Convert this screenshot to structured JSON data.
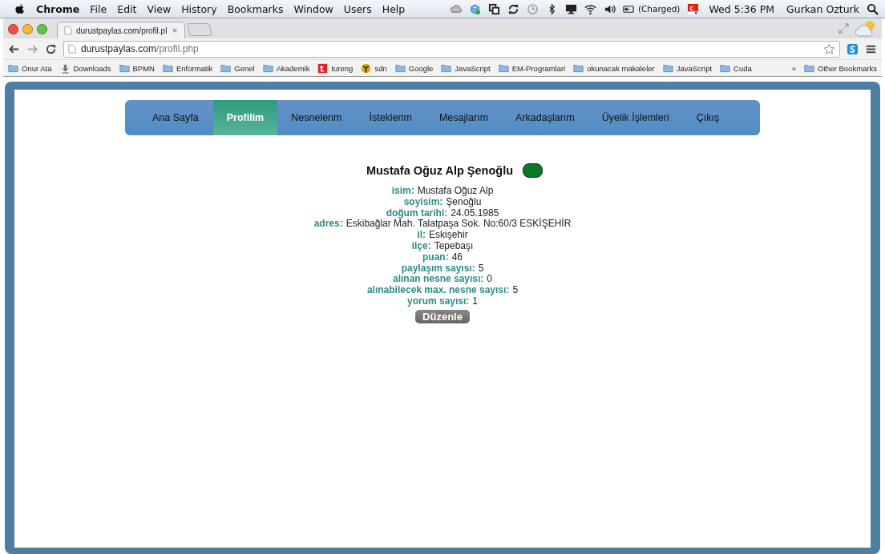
{
  "menu_bar": {
    "app": "Chrome",
    "items": [
      "File",
      "Edit",
      "View",
      "History",
      "Bookmarks",
      "Window",
      "Users",
      "Help"
    ],
    "battery": "(Charged)",
    "clock": "Wed 5:36 PM",
    "user": "Gurkan Ozturk"
  },
  "tabs": [
    {
      "label": "durustpaylas.com/profil.pl",
      "selected": true
    }
  ],
  "address": {
    "host": "durustpaylas.com",
    "path": "/profil.php"
  },
  "bookmarks": [
    {
      "label": "Onur Ata",
      "kind": "folder"
    },
    {
      "label": "Downloads",
      "kind": "download"
    },
    {
      "label": "BPMN",
      "kind": "folder"
    },
    {
      "label": "Enformatik",
      "kind": "folder"
    },
    {
      "label": "Genel",
      "kind": "folder"
    },
    {
      "label": "Akademik",
      "kind": "folder"
    },
    {
      "label": "tureng",
      "kind": "tureng"
    },
    {
      "label": "sdn",
      "kind": "sdn"
    },
    {
      "label": "Google",
      "kind": "folder"
    },
    {
      "label": "JavaScript",
      "kind": "folder"
    },
    {
      "label": "EM-Programlari",
      "kind": "folder"
    },
    {
      "label": "okunacak makaleler",
      "kind": "folder"
    },
    {
      "label": "JavaScript",
      "kind": "folder"
    },
    {
      "label": "Cuda",
      "kind": "folder"
    }
  ],
  "overflow": "»",
  "other_bookmarks": "Other Bookmarks",
  "nav": [
    {
      "label": "Ana Sayfa",
      "selected": false
    },
    {
      "label": "Profilim",
      "selected": true
    },
    {
      "label": "Nesnelerim",
      "selected": false
    },
    {
      "label": "İsteklerim",
      "selected": false
    },
    {
      "label": "Mesajlarım",
      "selected": false
    },
    {
      "label": "Arkadaşlarım",
      "selected": false
    },
    {
      "label": "Üyelik İşlemleri",
      "selected": false
    },
    {
      "label": "Çıkış",
      "selected": false
    }
  ],
  "profile": {
    "name": "Mustafa Oğuz Alp Şenoğlu",
    "status": {
      "color": "#08782a"
    },
    "fields": [
      {
        "label": "isim:",
        "value": "Mustafa Oğuz Alp"
      },
      {
        "label": "soyisim:",
        "value": "Şenoğlu"
      },
      {
        "label": "doğum tarihi:",
        "value": "24.05.1985"
      },
      {
        "label": "adres:",
        "value": "Eskibağlar Mah. Talatpaşa Sok. No:60/3 ESKİŞEHİR"
      },
      {
        "label": "il:",
        "value": "Eskişehir"
      },
      {
        "label": "ilçe:",
        "value": "Tepebaşı"
      },
      {
        "label": "puan:",
        "value": "46"
      },
      {
        "label": "paylaşım sayısı:",
        "value": "5"
      },
      {
        "label": "alınan nesne sayısı:",
        "value": "0"
      },
      {
        "label": "alınabilecek max. nesne sayısı:",
        "value": "5"
      },
      {
        "label": "yorum sayısı:",
        "value": "1"
      }
    ],
    "edit_button": "Düzenle"
  }
}
